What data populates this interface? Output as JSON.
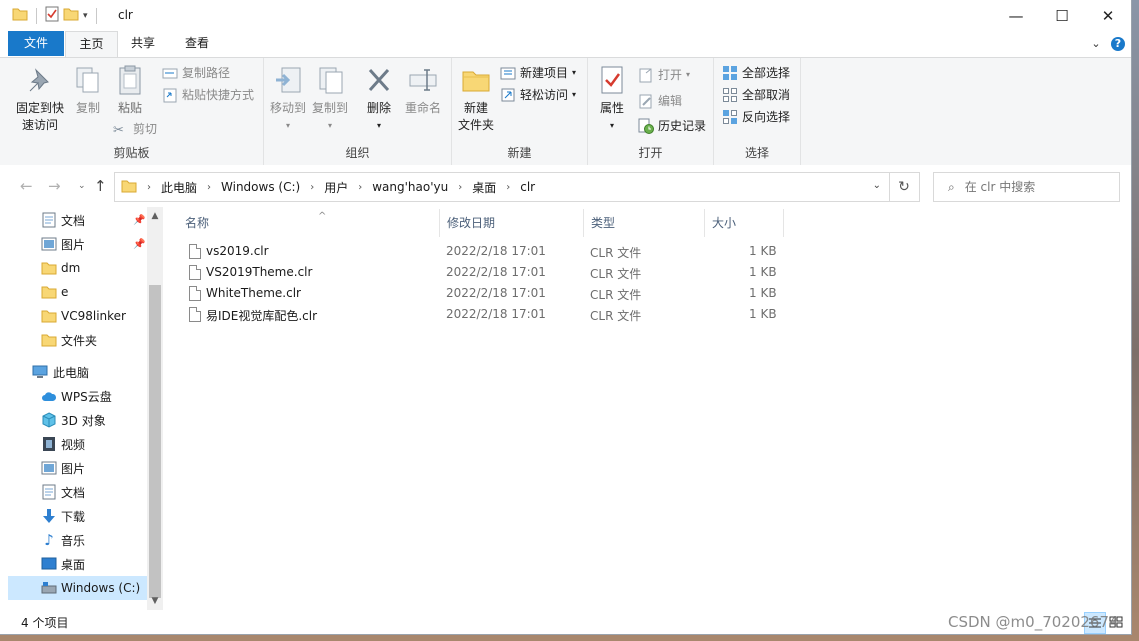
{
  "window": {
    "title": "clr"
  },
  "controls": {
    "minimize": "—",
    "maximize": "☐",
    "close": "✕"
  },
  "tabs": {
    "file": "文件",
    "home": "主页",
    "share": "共享",
    "view": "查看"
  },
  "ribbon": {
    "clipboard": {
      "pin_quick_access": "固定到快速访问",
      "pin_line1": "固定到快",
      "pin_line2": "速访问",
      "copy": "复制",
      "paste": "粘贴",
      "copy_path": "复制路径",
      "paste_shortcut": "粘贴快捷方式",
      "cut": "剪切",
      "label": "剪贴板"
    },
    "organize": {
      "move_to": "移动到",
      "copy_to": "复制到",
      "delete": "删除",
      "rename": "重命名",
      "label": "组织"
    },
    "new": {
      "new_folder_line1": "新建",
      "new_folder_line2": "文件夹",
      "new_item": "新建项目",
      "easy_access": "轻松访问",
      "label": "新建"
    },
    "open": {
      "properties": "属性",
      "open": "打开",
      "edit": "编辑",
      "history": "历史记录",
      "label": "打开"
    },
    "select": {
      "select_all": "全部选择",
      "select_none": "全部取消",
      "invert": "反向选择",
      "label": "选择"
    }
  },
  "address": {
    "crumbs": [
      "此电脑",
      "Windows (C:)",
      "用户",
      "wang'hao'yu",
      "桌面",
      "clr"
    ]
  },
  "search": {
    "placeholder": "在 clr 中搜索"
  },
  "nav": {
    "quick": [
      "文档",
      "图片",
      "dm",
      "e",
      "VC98linker",
      "文件夹"
    ],
    "this_pc": "此电脑",
    "pc_items": [
      "WPS云盘",
      "3D 对象",
      "视频",
      "图片",
      "文档",
      "下载",
      "音乐",
      "桌面",
      "Windows (C:)"
    ]
  },
  "columns": {
    "name": "名称",
    "modified": "修改日期",
    "type": "类型",
    "size": "大小"
  },
  "files": [
    {
      "name": "vs2019.clr",
      "modified": "2022/2/18 17:01",
      "type": "CLR 文件",
      "size": "1 KB"
    },
    {
      "name": "VS2019Theme.clr",
      "modified": "2022/2/18 17:01",
      "type": "CLR 文件",
      "size": "1 KB"
    },
    {
      "name": "WhiteTheme.clr",
      "modified": "2022/2/18 17:01",
      "type": "CLR 文件",
      "size": "1 KB"
    },
    {
      "name": "易IDE视觉库配色.clr",
      "modified": "2022/2/18 17:01",
      "type": "CLR 文件",
      "size": "1 KB"
    }
  ],
  "status": {
    "count": "4 个项目"
  },
  "watermark": "CSDN @m0_70202674",
  "colors": {
    "accent": "#1979ca",
    "selected": "#cce8ff",
    "folder": "#f8d775"
  }
}
